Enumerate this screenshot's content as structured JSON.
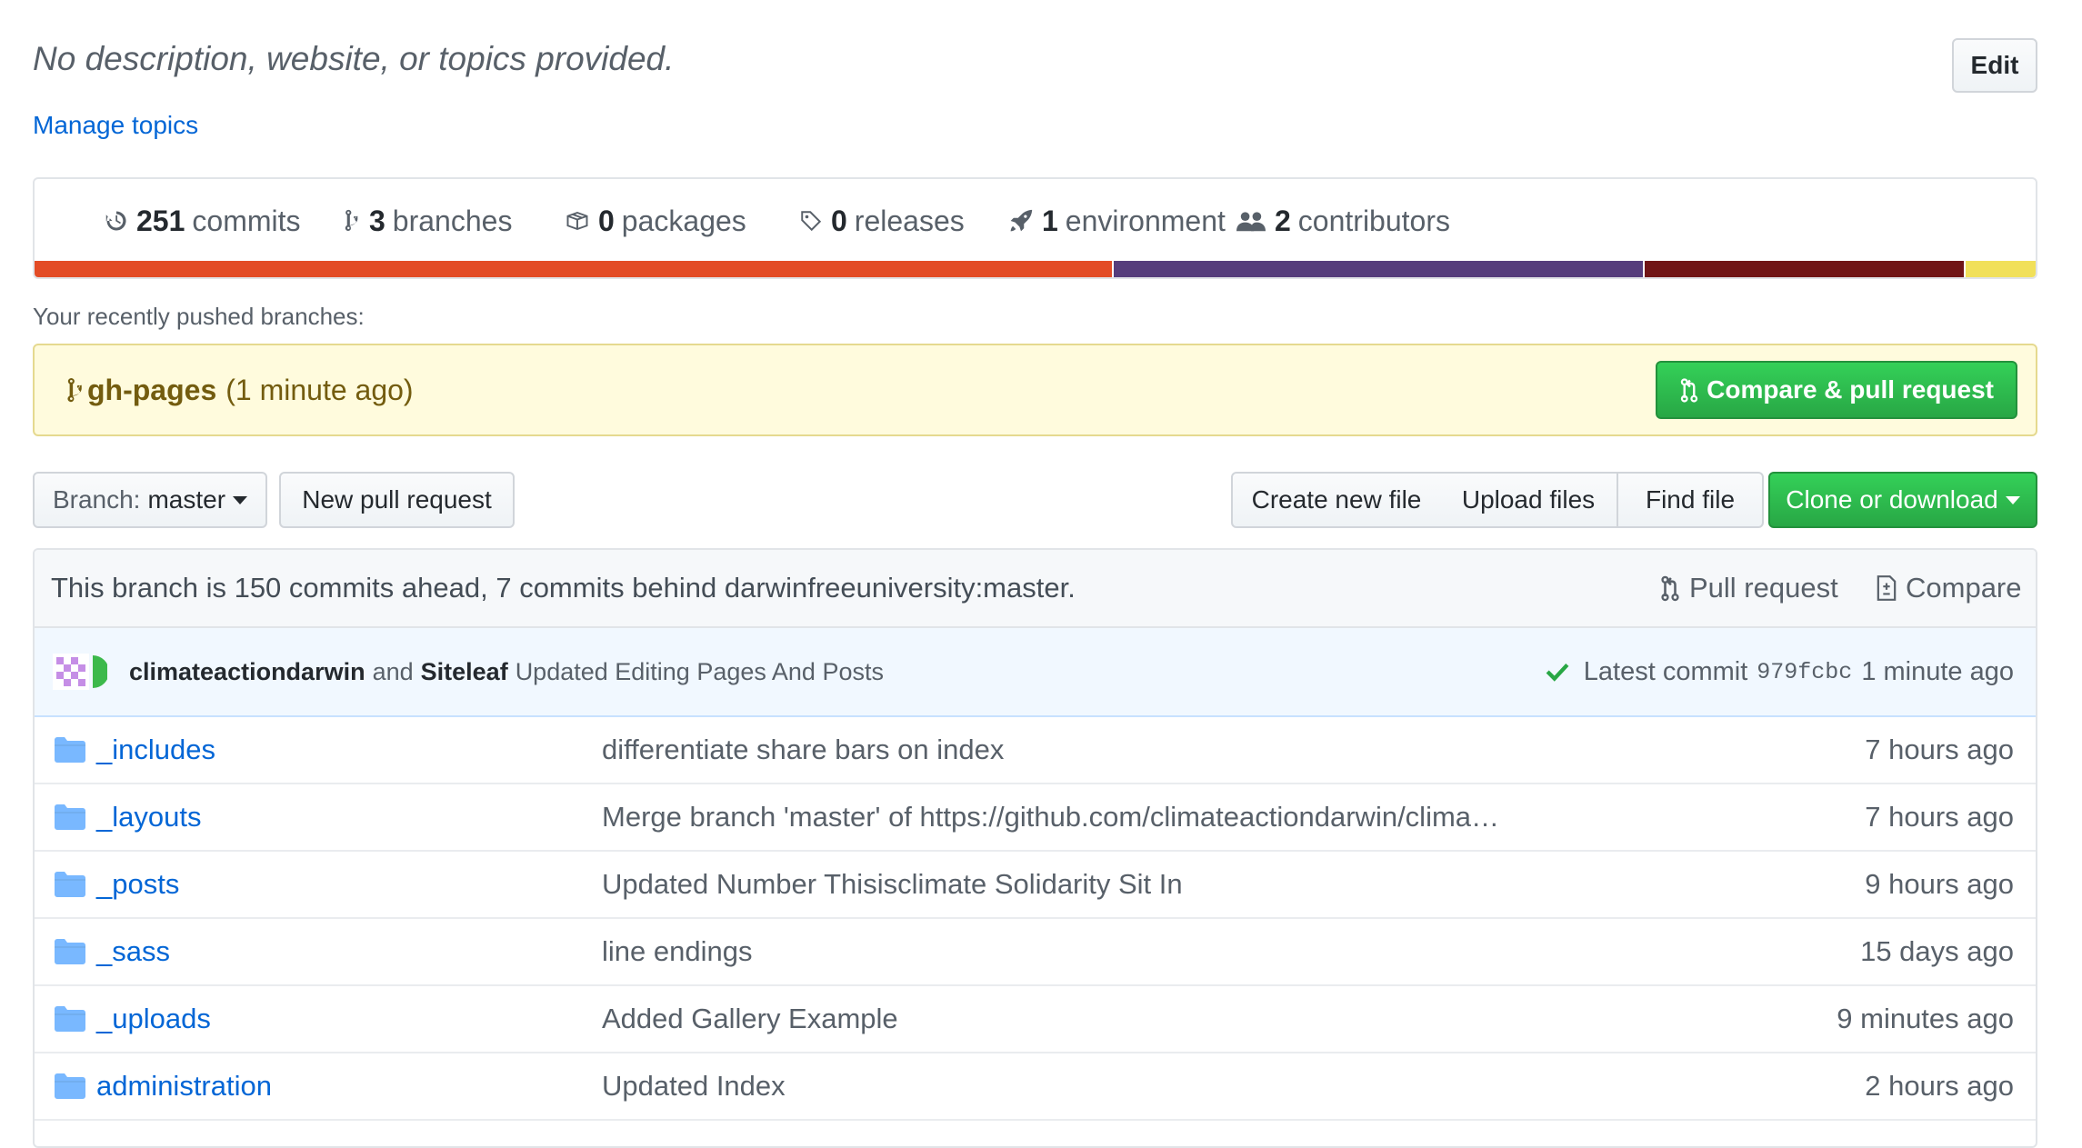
{
  "repo": {
    "description": "No description, website, or topics provided.",
    "edit_label": "Edit",
    "manage_topics": "Manage topics"
  },
  "summary": {
    "stats": [
      {
        "icon": "history-icon",
        "count": "251",
        "label": "commits"
      },
      {
        "icon": "git-branch-icon",
        "count": "3",
        "label": "branches"
      },
      {
        "icon": "package-icon",
        "count": "0",
        "label": "packages"
      },
      {
        "icon": "tag-icon",
        "count": "0",
        "label": "releases"
      },
      {
        "icon": "rocket-icon",
        "count": "1",
        "label": "environment"
      },
      {
        "icon": "people-icon",
        "count": "2",
        "label": "contributors"
      }
    ],
    "language_bar": [
      {
        "color": "#e34c26",
        "share": 0.54
      },
      {
        "color": "#563d7c",
        "share": 0.265
      },
      {
        "color": "#701516",
        "share": 0.16
      },
      {
        "color": "#f1e05a",
        "share": 0.035
      }
    ]
  },
  "recent": {
    "label": "Your recently pushed branches:",
    "branch": "gh-pages",
    "ago": "(1 minute ago)",
    "compare_button": "Compare & pull request"
  },
  "toolbar": {
    "branch_prefix": "Branch:",
    "branch_name": "master",
    "new_pr": "New pull request",
    "create_file": "Create new file",
    "upload_files": "Upload files",
    "find_file": "Find file",
    "clone": "Clone or download"
  },
  "branch_info": {
    "text": "This branch is 150 commits ahead, 7 commits behind darwinfreeuniversity:master.",
    "pull_request": "Pull request",
    "compare": "Compare"
  },
  "latest_commit": {
    "author1": "climateactiondarwin",
    "joiner": "and",
    "author2": "Siteleaf",
    "message": "Updated Editing Pages And Posts",
    "label": "Latest commit",
    "sha": "979fcbc",
    "ago": "1 minute ago"
  },
  "files": [
    {
      "name": "_includes",
      "message": "differentiate share bars on index",
      "age": "7 hours ago"
    },
    {
      "name": "_layouts",
      "message": "Merge branch 'master' of https://github.com/climateactiondarwin/clima…",
      "age": "7 hours ago"
    },
    {
      "name": "_posts",
      "message": "Updated Number Thisisclimate Solidarity Sit In",
      "age": "9 hours ago"
    },
    {
      "name": "_sass",
      "message": "line endings",
      "age": "15 days ago"
    },
    {
      "name": "_uploads",
      "message": "Added Gallery Example",
      "age": "9 minutes ago"
    },
    {
      "name": "administration",
      "message": "Updated Index",
      "age": "2 hours ago"
    }
  ]
}
